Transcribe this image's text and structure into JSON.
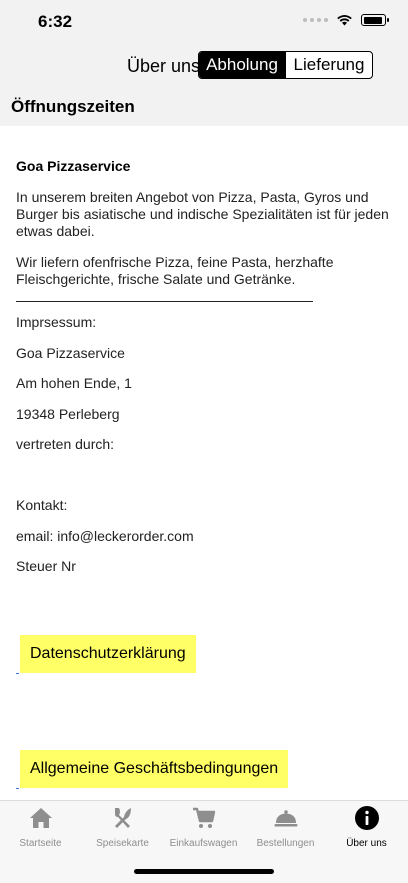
{
  "status_bar": {
    "time": "6:32"
  },
  "nav": {
    "title": "Über uns",
    "segments": [
      {
        "label": "Abholung",
        "selected": true
      },
      {
        "label": "Lieferung",
        "selected": false
      }
    ]
  },
  "section": {
    "title": "Öffnungszeiten"
  },
  "article": {
    "company": "Goa Pizzaservice",
    "paragraph1": "In unserem breiten Angebot von Pizza, Pasta, Gyros und Burger bis asiatische und indische Spezialitäten ist für jeden etwas dabei.",
    "paragraph2": "Wir liefern ofenfrische Pizza, feine Pasta, herzhafte Fleischgerichte, frische Salate und Getränke.",
    "imprint_label": "Imprsessum:",
    "imprint_name": "Goa Pizzaservice",
    "street": "Am hohen Ende, 1",
    "city": "19348 Perleberg",
    "represented_by": "vertreten durch:",
    "contact_label": "Kontakt:",
    "email": "email: info@leckerorder.com",
    "tax": "Steuer Nr"
  },
  "links": {
    "privacy": "Datenschutzerklärung",
    "terms": "Allgemeine Geschäftsbedingungen"
  },
  "tabs": [
    {
      "label": "Startseite",
      "icon": "home-icon",
      "active": false
    },
    {
      "label": "Speisekarte",
      "icon": "fork-knife-icon",
      "active": false
    },
    {
      "label": "Einkaufswagen",
      "icon": "cart-icon",
      "active": false
    },
    {
      "label": "Bestellungen",
      "icon": "cloche-icon",
      "active": false
    },
    {
      "label": "Über uns",
      "icon": "info-icon",
      "active": true
    }
  ],
  "colors": {
    "highlight": "#ffff66",
    "inactive_tab": "#8e8e8e",
    "active_tab": "#000000"
  }
}
